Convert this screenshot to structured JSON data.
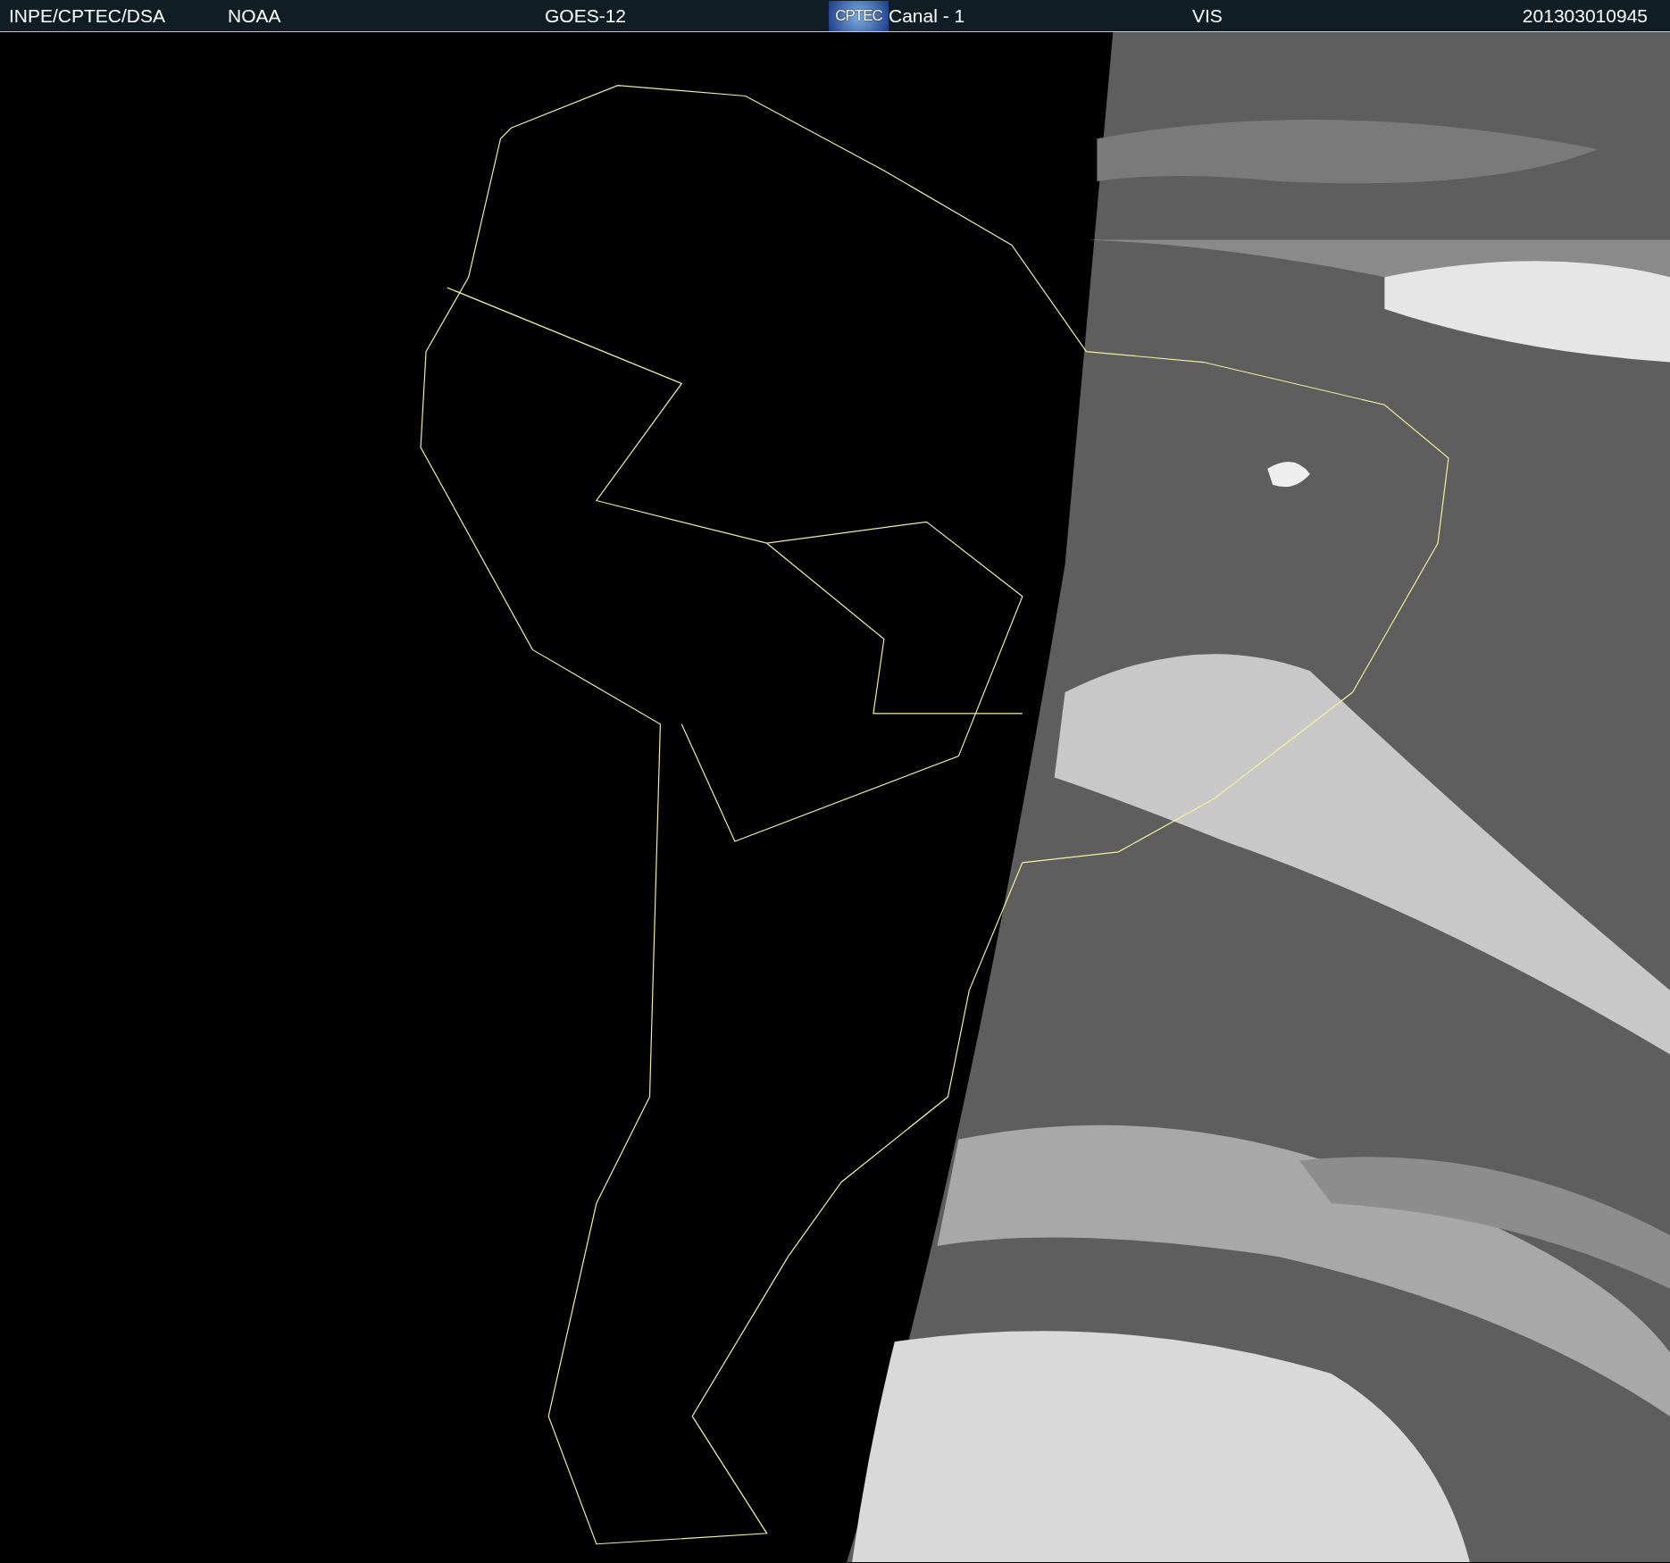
{
  "header": {
    "items": [
      {
        "kind": "text",
        "text": "INPE/CPTEC/DSA"
      },
      {
        "kind": "text",
        "text": "NOAA"
      },
      {
        "kind": "text",
        "text": "GOES-12"
      },
      {
        "kind": "logo",
        "text": "CPTEC"
      },
      {
        "kind": "text",
        "text": "Canal - 1"
      },
      {
        "kind": "text",
        "text": "VIS"
      },
      {
        "kind": "text",
        "text": "201303010945"
      }
    ]
  }
}
